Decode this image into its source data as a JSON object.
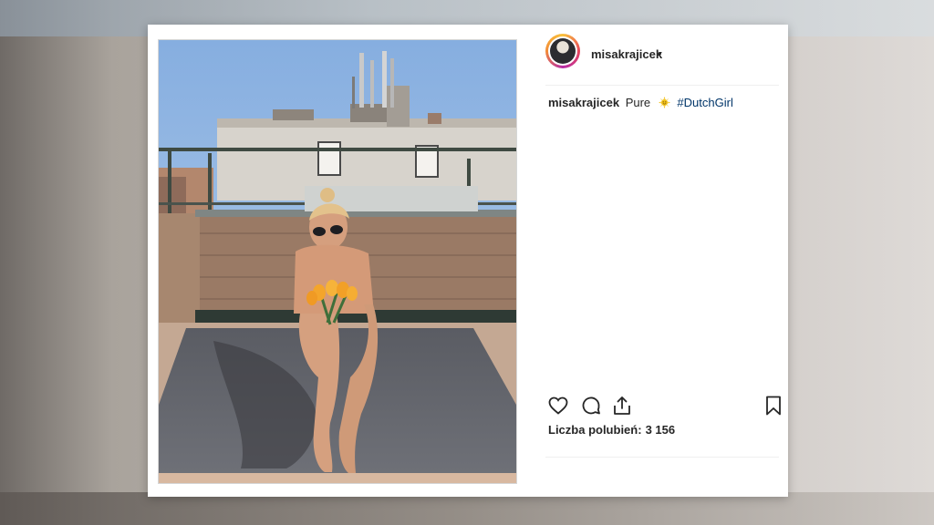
{
  "post": {
    "username": "misakrajicek",
    "header_dot": "•",
    "caption": {
      "username": "misakrajicek",
      "text": "Pure",
      "emoji": "sun-with-face-icon",
      "hashtag": "#DutchGirl"
    },
    "likes_label": "Liczba polubień:",
    "likes_count": "3 156",
    "photo_subject": "photo"
  },
  "colors": {
    "text": "#262626",
    "hashtag": "#003569",
    "divider": "#efefef",
    "card": "#ffffff"
  }
}
